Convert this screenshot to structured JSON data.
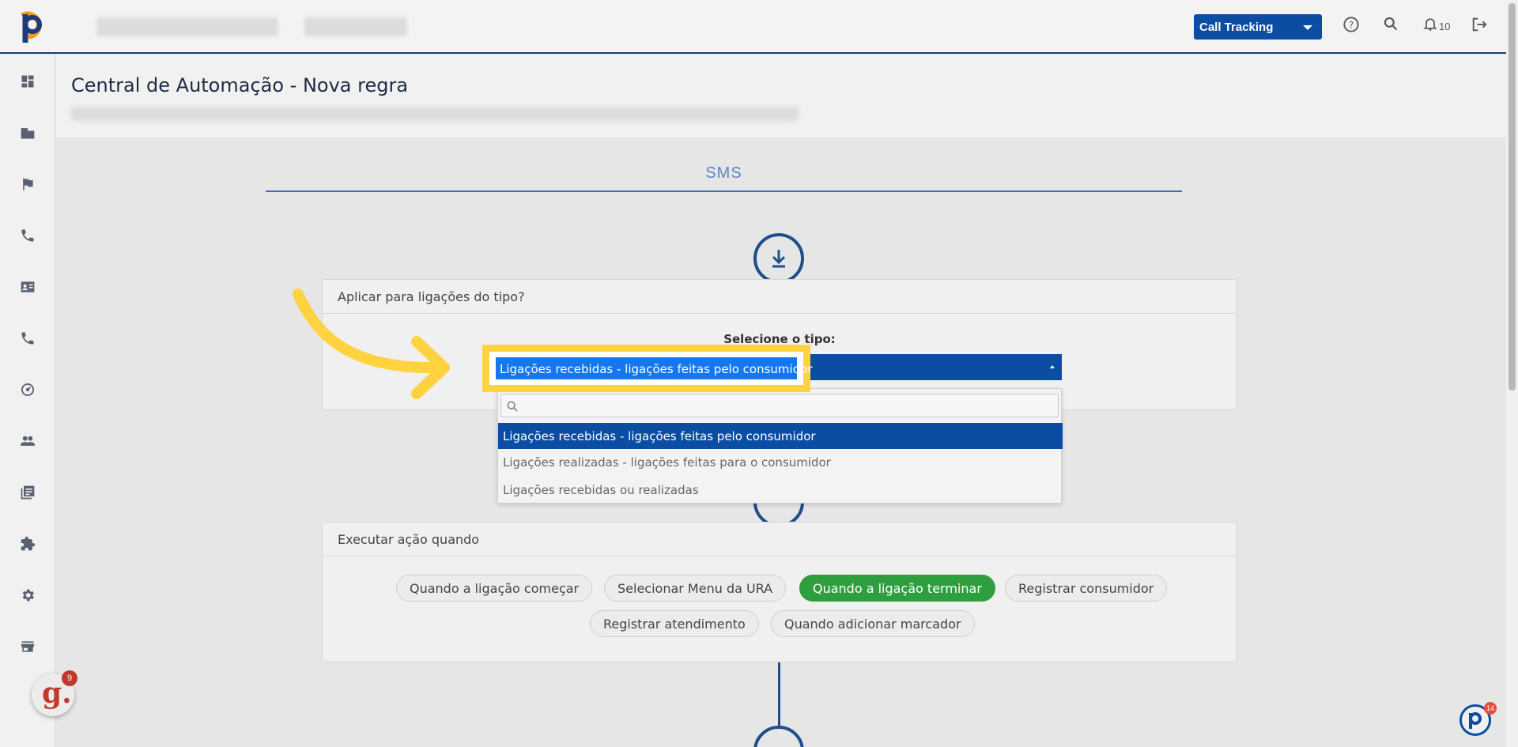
{
  "topbar": {
    "product_dropdown": "Call Tracking",
    "notifications_count": "10"
  },
  "page": {
    "title": "Central de Automação - Nova regra"
  },
  "tab": {
    "label": "SMS"
  },
  "card_type": {
    "header": "Aplicar para ligações do tipo?",
    "select_label": "Selecione o tipo:",
    "selected_value": "Ligações recebidas - ligações feitas pelo consumidor",
    "options": [
      "Ligações recebidas - ligações feitas pelo consumidor",
      "Ligações realizadas - ligações feitas para o consumidor",
      "Ligações recebidas ou realizadas"
    ]
  },
  "card_action": {
    "header": "Executar ação quando",
    "options": [
      "Quando a ligação começar",
      "Selecionar Menu da URA",
      "Quando a ligação terminar",
      "Registrar consumidor",
      "Registrar atendimento",
      "Quando adicionar marcador"
    ],
    "active_option": "Quando a ligação terminar"
  },
  "widgets": {
    "g_badge_letter": "g.",
    "g_badge_count": "9",
    "p_badge_count": "14"
  },
  "colors": {
    "primary": "#0b4da2",
    "highlight": "#ffd23f",
    "active_green": "#2e9e3e"
  }
}
